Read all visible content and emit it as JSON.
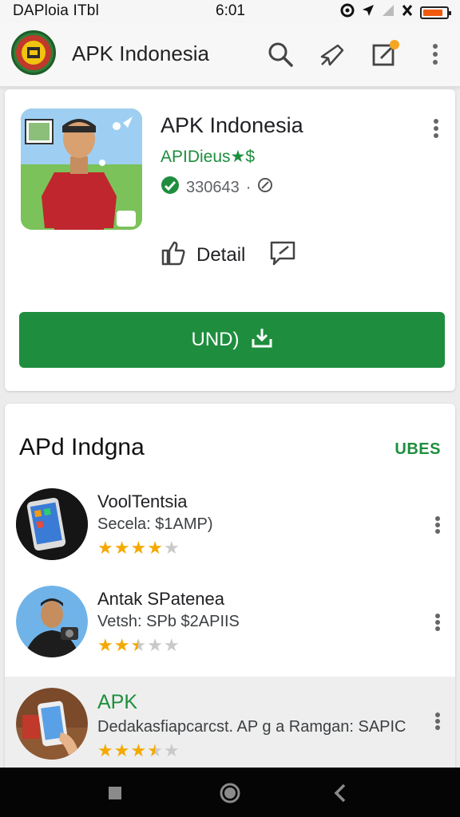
{
  "status_bar": {
    "left_text": "DAPloia  ITbl",
    "time": "6:01",
    "icons": [
      "data-saver-icon",
      "location-arrow-icon",
      "signal-icon",
      "no-sim-icon",
      "battery-icon"
    ],
    "battery_level": 0.85,
    "battery_color": "#f05a10"
  },
  "app_bar": {
    "logo_icon": "app-logo",
    "title": "APK Indonesia",
    "actions": [
      "search-icon",
      "share-icon",
      "edit-icon",
      "more-vert-icon"
    ],
    "notification_dot_color": "#f5a623"
  },
  "hero": {
    "app_name": "APK Indonesia",
    "developer": "APIDieus★$",
    "downloads": "330643",
    "detail_label": "Detail",
    "install_label": "UND)",
    "accent_color": "#1e8e3e"
  },
  "section": {
    "title": "APd Indgna",
    "more_label": "UBES"
  },
  "items": [
    {
      "title": "VoolTentsia",
      "subtitle": "Secela: $1AMP)",
      "rating": 4.0,
      "highlighted": false
    },
    {
      "title": "Antak SPatenea",
      "subtitle": "Vetsh: SPb  $2APIIS",
      "rating": 2.5,
      "highlighted": false
    },
    {
      "title": "APK",
      "subtitle": "Dedakasfiapcarcst. AP g a Ramgan: SAPIC",
      "rating": 3.5,
      "highlighted": true
    }
  ],
  "nav_bar": {
    "buttons": [
      "recents-square-icon",
      "home-circle-icon",
      "back-chevron-icon"
    ]
  }
}
